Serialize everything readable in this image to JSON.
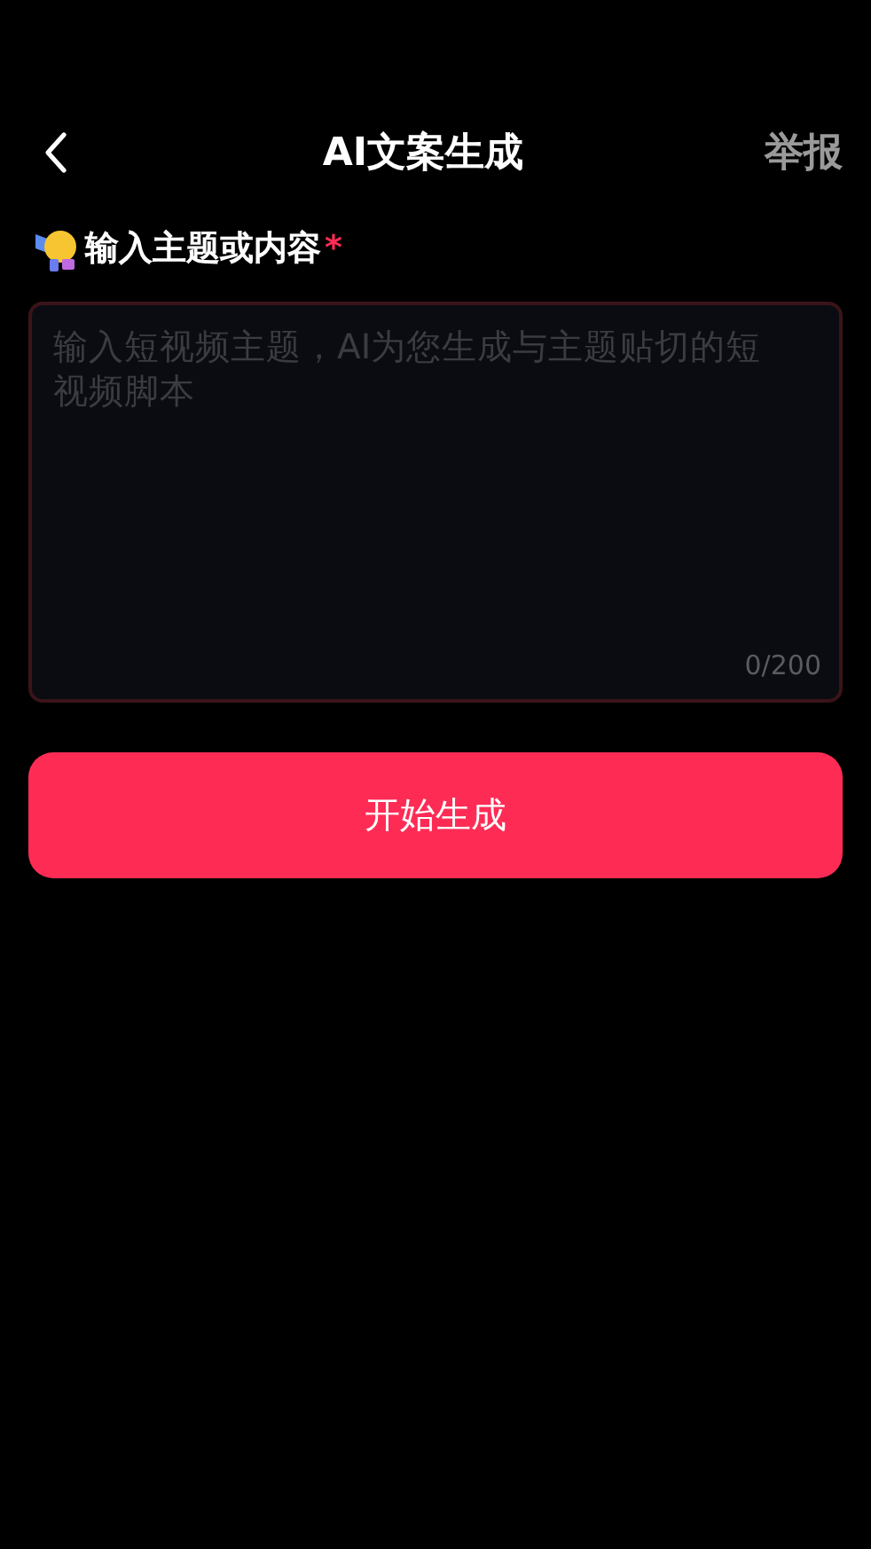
{
  "header": {
    "title": "AI文案生成",
    "action": "举报"
  },
  "prompt": {
    "label": "输入主题或内容",
    "required_mark": "*",
    "placeholder": "输入短视频主题，AI为您生成与主题贴切的短视频脚本",
    "counter": "0/200"
  },
  "submit_button": "开始生成"
}
